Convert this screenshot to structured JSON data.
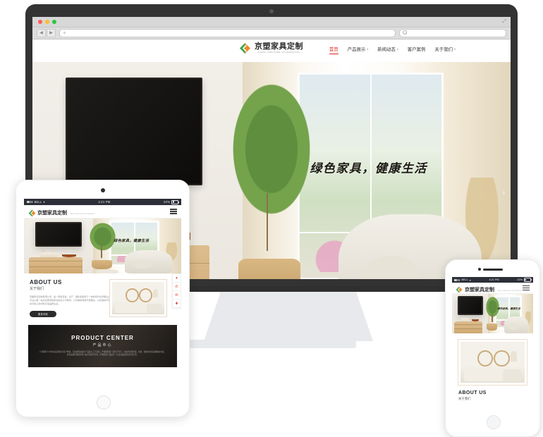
{
  "browser": {
    "window_controls": [
      "close",
      "minimize",
      "maximize"
    ],
    "back_icon": "◀",
    "forward_icon": "▶",
    "url_placeholder": "",
    "new_tab_icon": "+",
    "search_icon": "search-icon",
    "resize_icon": "⤢"
  },
  "site": {
    "logo": {
      "name_cn": "京塑家具定制",
      "tagline": "JINGSU FURNITURE CUSTOMIZATION",
      "mark_colors": {
        "green": "#3fa34d",
        "orange": "#f08a24"
      }
    },
    "nav": [
      {
        "label": "首页",
        "has_caret": false,
        "active": true
      },
      {
        "label": "产品展示",
        "has_caret": true,
        "active": false
      },
      {
        "label": "新闻动态",
        "has_caret": true,
        "active": false
      },
      {
        "label": "客户案例",
        "has_caret": false,
        "active": false
      },
      {
        "label": "关于我们",
        "has_caret": true,
        "active": false
      }
    ],
    "hero": {
      "headline": "绿色家具，健康生活",
      "prev_arrow": "‹",
      "next_arrow": "›",
      "slide_count": 2,
      "active_slide": 1
    },
    "about": {
      "title_en": "ABOUT US",
      "title_cn": "关于我们",
      "body": "京塑家具定制有限公司，是一家集研发、生产、销售和服务于一体的现代化家居企业，专业从事一站式全屋定制家具的设计与制作。公司秉承绿色环保理念，以优质的环保板材为核心原材料打造品质生活。",
      "button": "更多详情"
    },
    "product": {
      "title_en": "PRODUCT CENTER",
      "title_cn": "产品中心",
      "desc": "公司拥有十余年专业定制家具生产经验，引进德国先进生产设备与工艺流程，严格把控每一道生产环节，为客户提供环保、时尚、耐用的全屋定制解决方案。多年来我们始终坚持以客户需求为导向，不断创新产品设计，打造高品质家居生活空间。"
    },
    "side_icons": [
      {
        "name": "qq-icon",
        "glyph": "✦"
      },
      {
        "name": "phone-icon",
        "glyph": "✆"
      },
      {
        "name": "wechat-icon",
        "glyph": "✉"
      },
      {
        "name": "back-to-top-icon",
        "glyph": "✚"
      }
    ]
  },
  "tablet": {
    "status": {
      "carrier": "BELL",
      "wifi": "WiFi",
      "time": "4:21 PM",
      "battery": "22%"
    },
    "menu_icon": "hamburger-icon"
  },
  "phone": {
    "status": {
      "carrier": "BELL",
      "wifi": "WiFi",
      "time": "4:21 PM",
      "battery": "22%"
    },
    "menu_icon": "hamburger-icon"
  },
  "theme": {
    "accent_red": "#e2231a",
    "frame_dark": "#333333",
    "stand_gray": "#e7e9ec",
    "status_bar": "#2c2f38"
  }
}
